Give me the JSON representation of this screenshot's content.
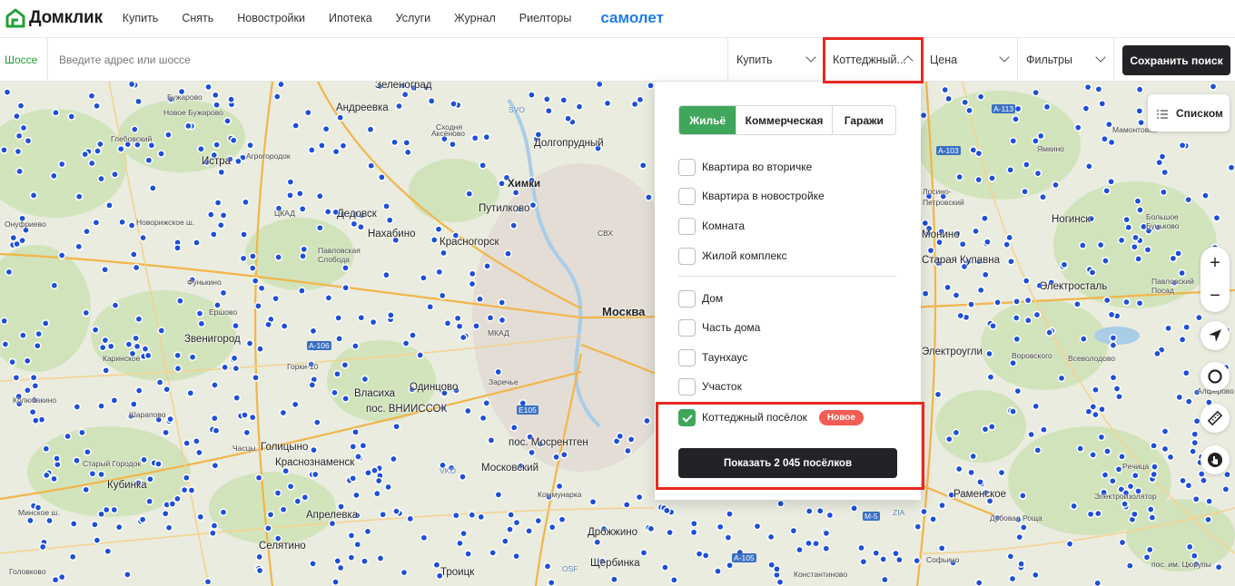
{
  "brand": {
    "logo_text": "Домклик",
    "partner": "самолет"
  },
  "nav": {
    "items": [
      "Купить",
      "Снять",
      "Новостройки",
      "Ипотека",
      "Услуги",
      "Журнал",
      "Риелторы"
    ]
  },
  "search": {
    "mode_tag": "Шоссе",
    "placeholder": "Введите адрес или шоссе",
    "deal_select": "Купить",
    "type_select": "Коттеджный...",
    "price_select": "Цена",
    "filters_select": "Фильтры",
    "save_button": "Сохранить поиск"
  },
  "map_controls": {
    "list_button": "Списком",
    "zoom_in": "+",
    "zoom_out": "−"
  },
  "panel": {
    "tabs": [
      {
        "label": "Жильё",
        "active": true
      },
      {
        "label": "Коммерческая",
        "active": false
      },
      {
        "label": "Гаражи",
        "active": false
      }
    ],
    "group1": [
      {
        "label": "Квартира во вторичке",
        "checked": false
      },
      {
        "label": "Квартира в новостройке",
        "checked": false
      },
      {
        "label": "Комната",
        "checked": false
      },
      {
        "label": "Жилой комплекс",
        "checked": false
      }
    ],
    "group2": [
      {
        "label": "Дом",
        "checked": false
      },
      {
        "label": "Часть дома",
        "checked": false
      },
      {
        "label": "Таунхаус",
        "checked": false
      },
      {
        "label": "Участок",
        "checked": false
      },
      {
        "label": "Коттеджный посёлок",
        "checked": true
      }
    ],
    "new_badge": "Новое",
    "show_button": "Показать 2 045 посёлков"
  },
  "map_labels": {
    "big": [
      "Москва",
      "Химки"
    ],
    "mid": [
      "Зеленоград",
      "Андреевка",
      "Истра",
      "Дедовск",
      "Нахабино",
      "Красногорск",
      "Путилково",
      "Долгопрудный",
      "Звенигород",
      "Одинцово",
      "Власиха",
      "пос. ВНИИССОК",
      "Голицыно",
      "Краснознаменск",
      "Московский",
      "пос. Мосрентген",
      "Апрелевка",
      "Селятино",
      "Троицк",
      "Щербинка",
      "Дрожжино",
      "Кубинка",
      "Ногинск",
      "Электросталь",
      "Раменское",
      "Мамонтовка",
      "Ямкино",
      "Лосино-Петровский",
      "Монино",
      "Старая Купавна",
      "Электроугли",
      "Часцы",
      "Горки-10"
    ],
    "small": [
      "Глебовский",
      "Бужарово",
      "Аксёново",
      "Онуфриево",
      "Фунькино",
      "Ершово",
      "Каринское",
      "Колюбакино",
      "Шарапово",
      "Старый Городок",
      "Головково",
      "Новое Бужарово",
      "Агрогородок",
      "Павловская Слобода",
      "Сходня",
      "Заречье",
      "Коммунарка",
      "Всеволодово",
      "Воровского",
      "Рeчица",
      "Электроизолятор",
      "Дубовая Роща",
      "Константиново",
      "пос. им. Цюрупы",
      "Большое Буньково",
      "Павловский Посад",
      "Алферово",
      "Софьино",
      "Минское ш.",
      "Новорижское ш."
    ],
    "tags": [
      "SVO",
      "VKO",
      "OSF",
      "ZIA",
      "СВХ",
      "МКАД",
      "ЦКАД",
      "A-113",
      "A-103",
      "E105",
      "M-5",
      "A-105",
      "A-106"
    ]
  }
}
